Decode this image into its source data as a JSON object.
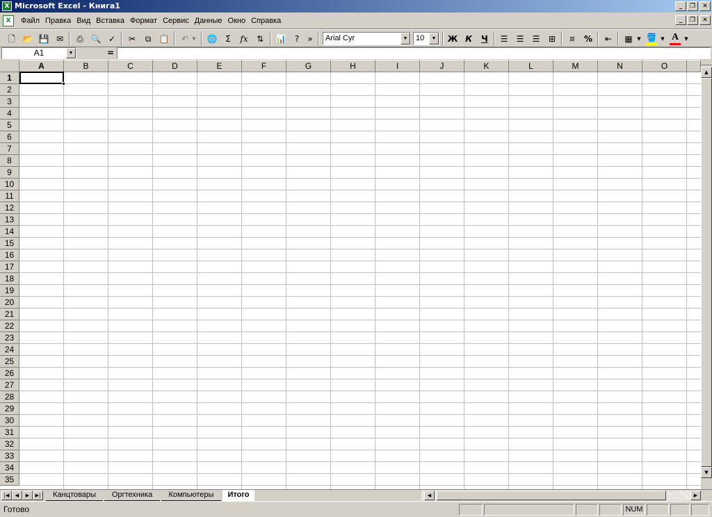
{
  "window": {
    "title": "Microsoft Excel - Книга1",
    "icon": "excel-icon"
  },
  "menu": {
    "items": [
      "Файл",
      "Правка",
      "Вид",
      "Вставка",
      "Формат",
      "Сервис",
      "Данные",
      "Окно",
      "Справка"
    ]
  },
  "toolbar": {
    "font_name": "Arial Cyr",
    "font_size": "10",
    "bold_label": "Ж",
    "italic_label": "К",
    "underline_label": "Ч",
    "sum_label": "Σ",
    "fx_label": "fx",
    "percent_label": "%",
    "more_label": "»",
    "accent_fill": "#ffff00",
    "accent_font": "#ff0000"
  },
  "formula_bar": {
    "name_box": "A1",
    "equals": "=",
    "value": ""
  },
  "grid": {
    "columns": [
      "A",
      "B",
      "C",
      "D",
      "E",
      "F",
      "G",
      "H",
      "I",
      "J",
      "K",
      "L",
      "M",
      "N",
      "O"
    ],
    "rows": [
      "1",
      "2",
      "3",
      "4",
      "5",
      "6",
      "7",
      "8",
      "9",
      "10",
      "11",
      "12",
      "13",
      "14",
      "15",
      "16",
      "17",
      "18",
      "19",
      "20",
      "21",
      "22",
      "23",
      "24",
      "25",
      "26",
      "27",
      "28",
      "29",
      "30",
      "31",
      "32",
      "33",
      "34",
      "35"
    ],
    "active_cell": "A1"
  },
  "sheets": {
    "tabs": [
      "Канцтовары",
      "Оргтехника",
      "Компьютеры",
      "Итого"
    ],
    "active": "Итого"
  },
  "status": {
    "text": "Готово",
    "num": "NUM"
  }
}
